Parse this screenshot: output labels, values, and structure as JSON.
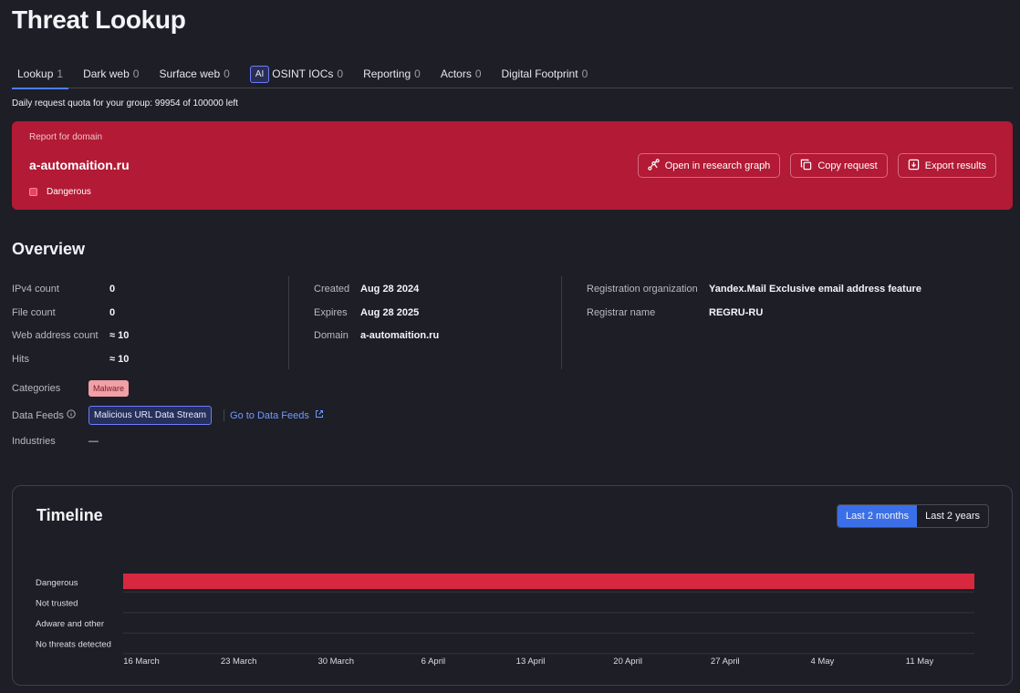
{
  "page_title": "Threat Lookup",
  "tabs": [
    {
      "label": "Lookup",
      "count": "1",
      "active": true
    },
    {
      "label": "Dark web",
      "count": "0"
    },
    {
      "label": "Surface web",
      "count": "0"
    },
    {
      "label": "OSINT IOCs",
      "count": "0",
      "badge": "AI"
    },
    {
      "label": "Reporting",
      "count": "0"
    },
    {
      "label": "Actors",
      "count": "0"
    },
    {
      "label": "Digital Footprint",
      "count": "0"
    }
  ],
  "quota": "Daily request quota for your group: 99954 of 100000 left",
  "report": {
    "label": "Report for domain",
    "domain": "a-automaition.ru",
    "status": "Dangerous",
    "actions": {
      "open_graph": "Open in research graph",
      "copy_request": "Copy request",
      "export_results": "Export results"
    },
    "colors": {
      "background": "#b21a35"
    }
  },
  "overview": {
    "title": "Overview",
    "col1": [
      {
        "key": "IPv4 count",
        "value": "0"
      },
      {
        "key": "File count",
        "value": "0"
      },
      {
        "key": "Web address count",
        "value": "≈ 10"
      },
      {
        "key": "Hits",
        "value": "≈ 10"
      }
    ],
    "col2": [
      {
        "key": "Created",
        "value": "Aug 28 2024"
      },
      {
        "key": "Expires",
        "value": "Aug 28 2025"
      },
      {
        "key": "Domain",
        "value": "a-automaition.ru"
      }
    ],
    "col3": [
      {
        "key": "Registration organization",
        "value": "Yandex.Mail Exclusive email address feature"
      },
      {
        "key": "Registrar name",
        "value": "REGRU-RU"
      }
    ],
    "categories_label": "Categories",
    "categories": [
      "Malware"
    ],
    "feeds_label": "Data Feeds",
    "feeds": [
      "Malicious URL Data Stream"
    ],
    "feeds_link": "Go to Data Feeds",
    "industries_label": "Industries",
    "industries_value": "—"
  },
  "timeline": {
    "title": "Timeline",
    "ranges": [
      {
        "label": "Last 2 months",
        "active": true
      },
      {
        "label": "Last 2 years",
        "active": false
      }
    ]
  },
  "chart_data": {
    "type": "bar",
    "orientation": "horizontal-timeline",
    "categories": [
      "Dangerous",
      "Not trusted",
      "Adware and other",
      "No threats detected"
    ],
    "x_tick_labels": [
      "16 March",
      "23 March",
      "30 March",
      "6 April",
      "13 April",
      "20 April",
      "27 April",
      "4 May",
      "11 May"
    ],
    "series": [
      {
        "category": "Dangerous",
        "start": "16 March",
        "end": "11 May",
        "color": "#d8283f"
      }
    ],
    "grid": true
  }
}
